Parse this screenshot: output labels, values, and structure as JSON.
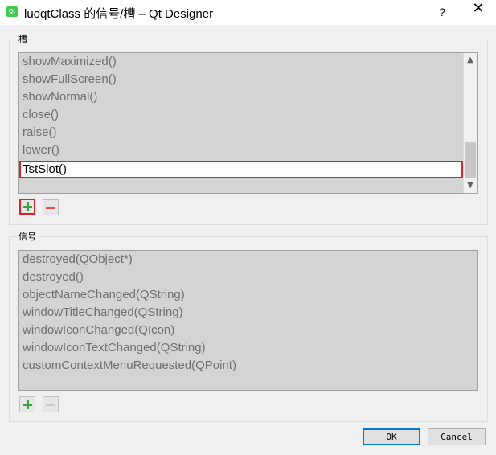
{
  "window": {
    "icon_text": "Qt",
    "title": "luoqtClass 的信号/槽 – Qt Designer",
    "help": "?",
    "close": "✕"
  },
  "slots_group": {
    "title": "槽",
    "items": [
      "showMaximized()",
      "showFullScreen()",
      "showNormal()",
      "close()",
      "raise()",
      "lower()",
      "TstSlot()"
    ],
    "selected_item": "TstSlot()",
    "scrollbar": {
      "up": "▲",
      "down": "▼"
    }
  },
  "signals_group": {
    "title": "信号",
    "items": [
      "destroyed(QObject*)",
      "destroyed()",
      "objectNameChanged(QString)",
      "windowTitleChanged(QString)",
      "windowIconChanged(QIcon)",
      "windowIconTextChanged(QString)",
      "customContextMenuRequested(QPoint)"
    ]
  },
  "buttons": {
    "ok": "OK",
    "cancel": "Cancel"
  },
  "colors": {
    "selection_border": "#d9232a",
    "default_button_border": "#0078d7",
    "plus_icon": "#3ca33c",
    "minus_icon": "#e05050"
  }
}
